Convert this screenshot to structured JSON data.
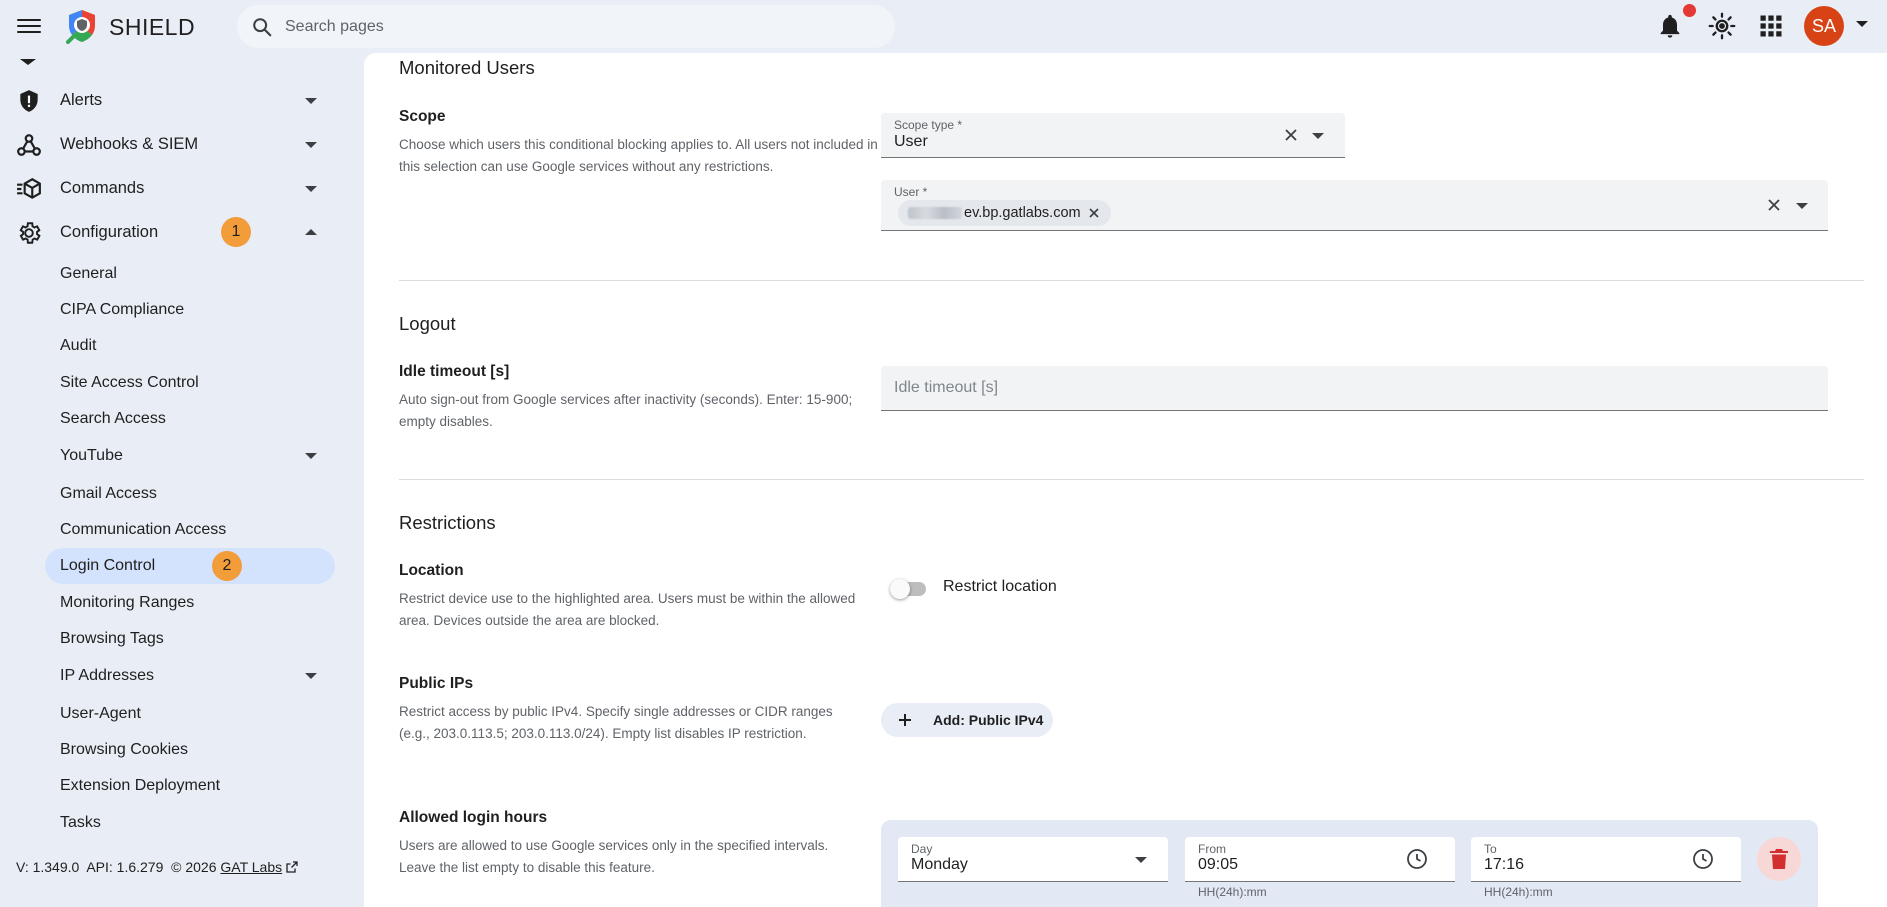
{
  "header": {
    "brand": "SHIELD",
    "search_placeholder": "Search pages",
    "avatar_initials": "SA"
  },
  "sidebar": {
    "items": [
      {
        "label": "Alerts",
        "icon": "shield-icon"
      },
      {
        "label": "Webhooks & SIEM",
        "icon": "webhook-icon"
      },
      {
        "label": "Commands",
        "icon": "commands-icon"
      },
      {
        "label": "Configuration",
        "icon": "gear-icon",
        "badge": "1"
      }
    ],
    "config_items": [
      "General",
      "CIPA Compliance",
      "Audit",
      "Site Access Control",
      "Search Access",
      "YouTube",
      "Gmail Access",
      "Communication Access",
      "Login Control",
      "Monitoring Ranges",
      "Browsing Tags",
      "IP Addresses",
      "User-Agent",
      "Browsing Cookies",
      "Extension Deployment",
      "Tasks"
    ],
    "active_badge": "2",
    "version_text": "V: 1.349.0  API: 1.6.279  © 2026",
    "version_link": "GAT Labs"
  },
  "monitored": {
    "title": "Monitored Users",
    "scope_label": "Scope",
    "scope_desc": "Choose which users this conditional blocking applies to. All users not included in this selection can use Google services without any restrictions.",
    "scope_type_label": "Scope type *",
    "scope_type_value": "User",
    "user_label": "User *",
    "user_chip": "ev.bp.gatlabs.com"
  },
  "logout": {
    "title": "Logout",
    "idle_label": "Idle timeout [s]",
    "idle_desc": "Auto sign-out from Google services after inactivity (seconds). Enter: 15-900; empty disables.",
    "idle_placeholder": "Idle timeout [s]"
  },
  "restrictions": {
    "title": "Restrictions",
    "location_label": "Location",
    "location_desc": "Restrict device use to the highlighted area. Users must be within the allowed area. Devices outside the area are blocked.",
    "location_toggle_label": "Restrict location",
    "location_toggle_on": false,
    "public_ips_label": "Public IPs",
    "public_ips_desc": "Restrict access by public IPv4. Specify single addresses or CIDR ranges (e.g., 203.0.113.5; 203.0.113.0/24). Empty list disables IP restriction.",
    "add_ip_label": "Add: Public IPv4",
    "hours_label": "Allowed login hours",
    "hours_desc": "Users are allowed to use Google services only in the specified intervals. Leave the list empty to disable this feature.",
    "hours_row": {
      "day_label": "Day",
      "day_value": "Monday",
      "from_label": "From",
      "from_value": "09:05",
      "to_label": "To",
      "to_value": "17:16",
      "hint": "HH(24h):mm"
    }
  },
  "colors": {
    "accent_bg": "#e9eef6",
    "active_item": "#d3e3fd",
    "badge": "#f39c3a",
    "avatar": "#d84315",
    "delete": "#d32f2f"
  }
}
